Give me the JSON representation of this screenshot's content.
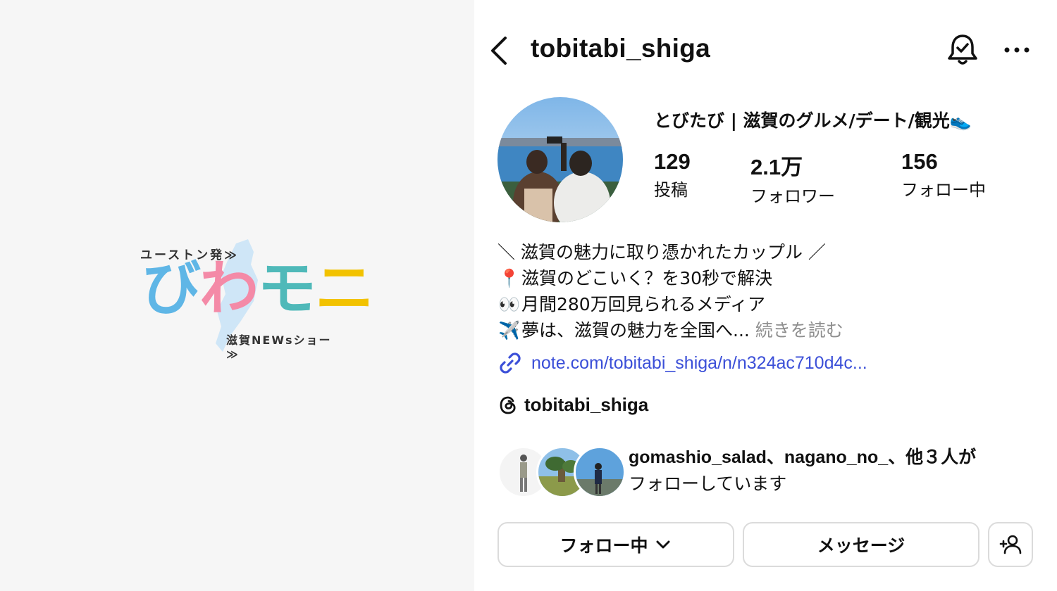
{
  "logo": {
    "top_text": "ユーストン発≫",
    "main_chars": [
      "び",
      "わ",
      "モ",
      "ニ"
    ],
    "bottom_text": "滋賀NEWsショー≫"
  },
  "header": {
    "username": "tobitabi_shiga",
    "back_icon": "chevron-left-icon",
    "bell_icon": "bell-check-icon",
    "more_icon": "more-dots-icon"
  },
  "profile": {
    "display_name": "とびたび | 滋賀のグルメ/デート/観光",
    "display_name_emoji": "👟",
    "stats": [
      {
        "value": "129",
        "label": "投稿"
      },
      {
        "value": "2.1万",
        "label": "フォロワー"
      },
      {
        "value": "156",
        "label": "フォロー中"
      }
    ],
    "bio": [
      {
        "emoji": "",
        "text": "＼ 滋賀の魅力に取り憑かれたカップル ／"
      },
      {
        "emoji": "📍",
        "text": "滋賀のどこいく？を30秒で解決"
      },
      {
        "emoji": "👀",
        "text": "月間280万回見られるメディア"
      },
      {
        "emoji": "✈️",
        "text": "夢は、滋賀の魅力を全国へ..."
      }
    ],
    "bio_more": "続きを読む",
    "link": "note.com/tobitabi_shiga/n/n324ac710d4c...",
    "threads_handle": "tobitabi_shiga"
  },
  "mutual": {
    "line1": "gomashio_salad、nagano_no_、他３人が",
    "line2": "フォローしています"
  },
  "buttons": {
    "follow": "フォロー中",
    "message": "メッセージ"
  },
  "colors": {
    "link": "#3b4fd8",
    "muted": "#8e8e8e",
    "border": "#dbdbdb"
  }
}
